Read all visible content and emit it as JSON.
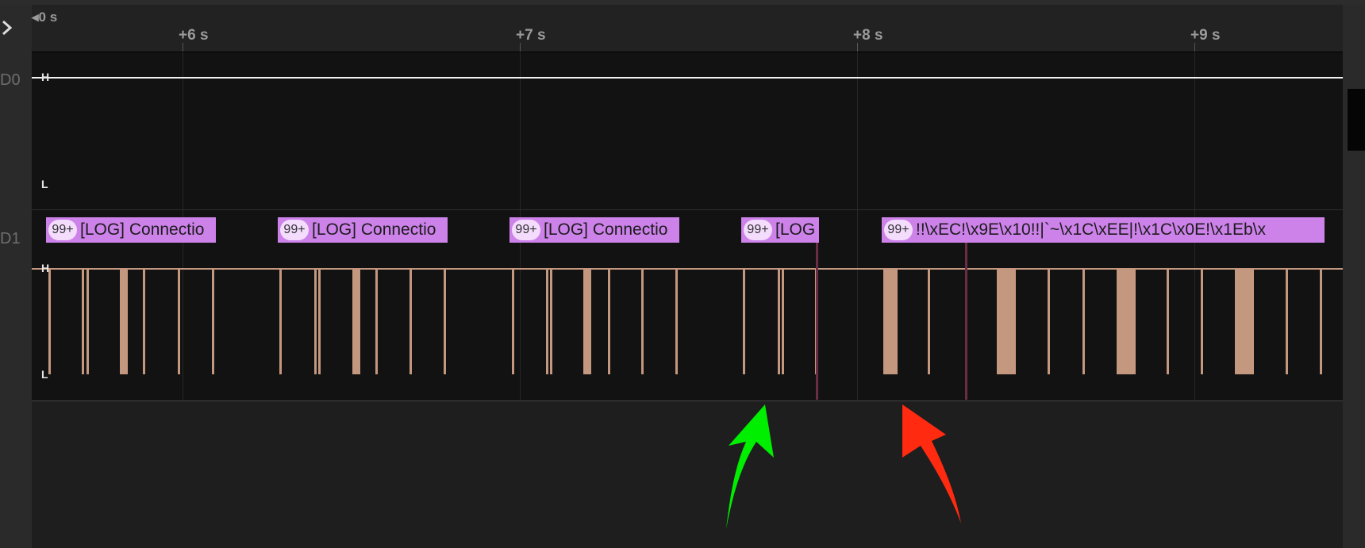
{
  "timeline": {
    "origin_label": "0 s",
    "ticks": [
      {
        "label": "+6 s"
      },
      {
        "label": "+7 s"
      },
      {
        "label": "+8 s"
      },
      {
        "label": "+9 s"
      }
    ]
  },
  "channels": [
    {
      "name": "D0",
      "high_label": "H",
      "low_label": "L",
      "trace_color": "#f2f2f2"
    },
    {
      "name": "D1",
      "high_label": "H",
      "low_label": "L",
      "trace_color": "#c4977f"
    }
  ],
  "annotations": [
    {
      "badge": "99+",
      "text": "[LOG] Connectio"
    },
    {
      "badge": "99+",
      "text": "[LOG] Connectio"
    },
    {
      "badge": "99+",
      "text": "[LOG] Connectio"
    },
    {
      "badge": "99+",
      "text": "[LOG"
    },
    {
      "badge": "99+",
      "text": "!!\\xEC!\\x9E\\x10!!|`~\\x1C\\xEE|!\\x1C\\x0E!\\x1Eb\\x"
    }
  ],
  "colors": {
    "background": "#1e1e1e",
    "lane_background": "#121212",
    "annotation_bg": "#cd82ea",
    "annotation_badge_bg": "#f4dcfd",
    "marker": "#6b2d45",
    "arrow_green": "#00ee00",
    "arrow_red": "#ff2a10"
  },
  "icons": {
    "expand": "chevron-right-icon",
    "origin": "triangle-left-icon"
  }
}
